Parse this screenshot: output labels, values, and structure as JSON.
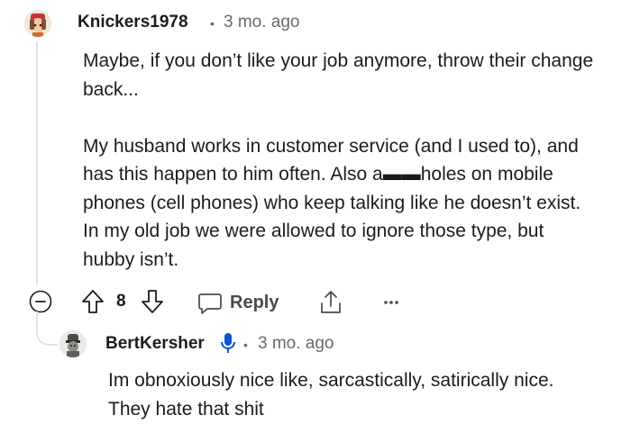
{
  "comment": {
    "author": "Knickers1978",
    "separator": "•",
    "time": "3 mo. ago",
    "paragraphs": [
      "Maybe, if you don’t like your job anymore, throw their change back...",
      "My husband works in customer service (and I used to), and has this happen to him often. Also a▬▬hole​s on mobile phones (cell phones) who keep talking like he doesn’t exist. In my old job we were allowed to ignore those type, but hubby isn’t."
    ],
    "vote_count": "8",
    "reply_label": "Reply",
    "icons": [
      "collapse-icon",
      "upvote-icon",
      "downvote-icon",
      "reply-icon",
      "share-icon",
      "more-icon"
    ]
  },
  "reply": {
    "author": "BertKersher",
    "separator": "•",
    "time": "3 mo. ago",
    "text": "Im obnoxiously nice like, sarcastically, satirically nice. They hate that shit",
    "icons": [
      "microphone-icon"
    ]
  }
}
